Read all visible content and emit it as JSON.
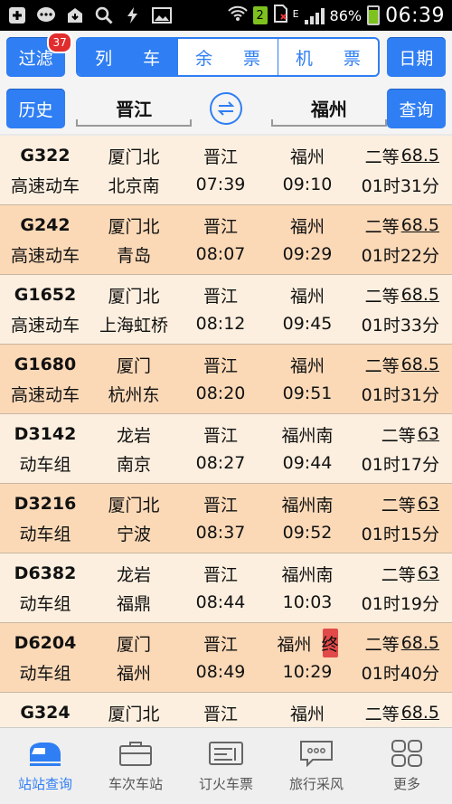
{
  "status_bar": {
    "battery": "86%",
    "time": "06:39",
    "network_letter": "E",
    "sim_number": "2"
  },
  "toolbar": {
    "filter_label": "过滤",
    "filter_badge": "37",
    "segments": [
      "列 车",
      "余 票",
      "机 票"
    ],
    "active_segment": 0,
    "date_label": "日期",
    "history_label": "历史",
    "from_station": "晋江",
    "to_station": "福州",
    "query_label": "查询"
  },
  "trains": [
    {
      "code": "G322",
      "type": "高速动车",
      "origin": "厦门北",
      "terminus": "北京南",
      "from": "晋江",
      "to": "福州",
      "depart": "07:39",
      "arrive": "09:10",
      "seat": "二等",
      "price": "68.5",
      "duration": "01时31分",
      "end": false
    },
    {
      "code": "G242",
      "type": "高速动车",
      "origin": "厦门北",
      "terminus": "青岛",
      "from": "晋江",
      "to": "福州",
      "depart": "08:07",
      "arrive": "09:29",
      "seat": "二等",
      "price": "68.5",
      "duration": "01时22分",
      "end": false
    },
    {
      "code": "G1652",
      "type": "高速动车",
      "origin": "厦门北",
      "terminus": "上海虹桥",
      "from": "晋江",
      "to": "福州",
      "depart": "08:12",
      "arrive": "09:45",
      "seat": "二等",
      "price": "68.5",
      "duration": "01时33分",
      "end": false
    },
    {
      "code": "G1680",
      "type": "高速动车",
      "origin": "厦门",
      "terminus": "杭州东",
      "from": "晋江",
      "to": "福州",
      "depart": "08:20",
      "arrive": "09:51",
      "seat": "二等",
      "price": "68.5",
      "duration": "01时31分",
      "end": false
    },
    {
      "code": "D3142",
      "type": "动车组",
      "origin": "龙岩",
      "terminus": "南京",
      "from": "晋江",
      "to": "福州南",
      "depart": "08:27",
      "arrive": "09:44",
      "seat": "二等",
      "price": "63",
      "duration": "01时17分",
      "end": false
    },
    {
      "code": "D3216",
      "type": "动车组",
      "origin": "厦门北",
      "terminus": "宁波",
      "from": "晋江",
      "to": "福州南",
      "depart": "08:37",
      "arrive": "09:52",
      "seat": "二等",
      "price": "63",
      "duration": "01时15分",
      "end": false
    },
    {
      "code": "D6382",
      "type": "动车组",
      "origin": "龙岩",
      "terminus": "福鼎",
      "from": "晋江",
      "to": "福州南",
      "depart": "08:44",
      "arrive": "10:03",
      "seat": "二等",
      "price": "63",
      "duration": "01时19分",
      "end": false
    },
    {
      "code": "D6204",
      "type": "动车组",
      "origin": "厦门",
      "terminus": "福州",
      "from": "晋江",
      "to": "福州",
      "depart": "08:49",
      "arrive": "10:29",
      "seat": "二等",
      "price": "68.5",
      "duration": "01时40分",
      "end": true,
      "end_label": "终"
    },
    {
      "code": "G324",
      "type": "",
      "origin": "厦门北",
      "terminus": "",
      "from": "晋江",
      "to": "福州",
      "depart": "",
      "arrive": "",
      "seat": "二等",
      "price": "68.5",
      "duration": "",
      "end": false
    }
  ],
  "bottom_nav": [
    {
      "label": "站站查询",
      "icon": "train-icon",
      "active": true
    },
    {
      "label": "车次车站",
      "icon": "briefcase-icon",
      "active": false
    },
    {
      "label": "订火车票",
      "icon": "ticket-icon",
      "active": false
    },
    {
      "label": "旅行采风",
      "icon": "chat-icon",
      "active": false
    },
    {
      "label": "更多",
      "icon": "grid-icon",
      "active": false
    }
  ],
  "colors": {
    "accent": "#2f7ef3",
    "row_light": "#fcefdf",
    "row_dark": "#fbd9b7",
    "price": "#c2163a"
  }
}
